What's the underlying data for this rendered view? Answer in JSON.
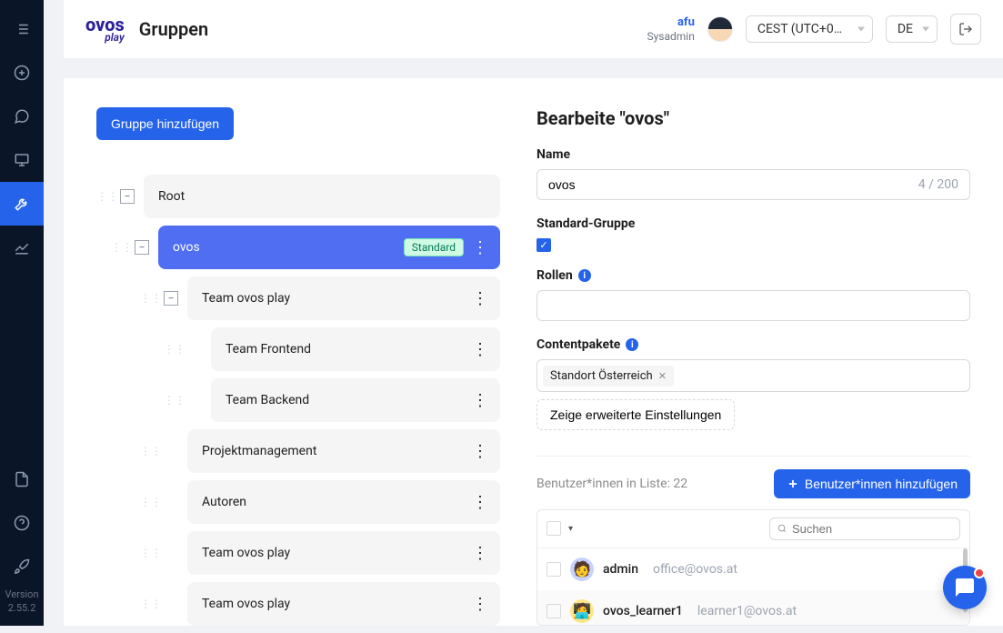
{
  "header": {
    "logo_main": "ovos",
    "logo_sub": "play",
    "page_title": "Gruppen",
    "user": {
      "name": "afu",
      "role": "Sysadmin"
    },
    "timezone": "CEST (UTC+0…",
    "lang": "DE"
  },
  "sidebar": {
    "version_label": "Version",
    "version_value": "2.55.2"
  },
  "left": {
    "add_group_btn": "Gruppe hinzufügen",
    "nodes": {
      "root": "Root",
      "ovos": "ovos",
      "standard_badge": "Standard",
      "team_play1": "Team ovos play",
      "frontend": "Team Frontend",
      "backend": "Team Backend",
      "pm": "Projektmanagement",
      "autoren": "Autoren",
      "team_play2": "Team ovos play",
      "team_play3": "Team ovos play"
    }
  },
  "right": {
    "title": "Bearbeite \"ovos\"",
    "name_label": "Name",
    "name_value": "ovos",
    "name_counter": "4 / 200",
    "std_group_label": "Standard-Gruppe",
    "roles_label": "Rollen",
    "content_label": "Contentpakete",
    "content_tag": "Standort Österreich",
    "advanced_btn": "Zeige erweiterte Einstellungen",
    "user_count_label": "Benutzer*innen in Liste: 22",
    "add_user_btn": "Benutzer*innen hinzufügen",
    "search_placeholder": "Suchen",
    "users": [
      {
        "name": "admin",
        "email": "office@ovos.at"
      },
      {
        "name": "ovos_learner1",
        "email": "learner1@ovos.at"
      }
    ]
  }
}
